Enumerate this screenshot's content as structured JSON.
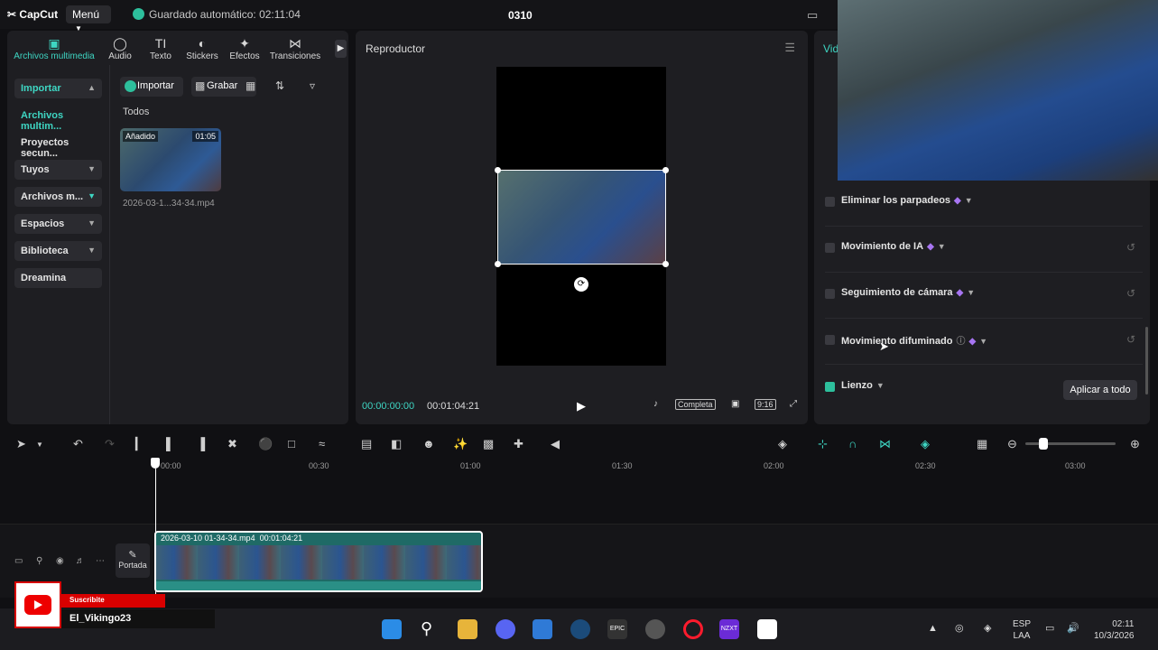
{
  "titlebar": {
    "logo": "CapCut",
    "menu_label": "Menú",
    "autosave": "Guardado automático: 02:11:04",
    "project": "0310"
  },
  "media_tabs": [
    {
      "label": "Archivos multimedia",
      "icon": "media-icon",
      "active": true
    },
    {
      "label": "Audio",
      "icon": "audio-icon"
    },
    {
      "label": "Texto",
      "icon": "text-icon"
    },
    {
      "label": "Stickers",
      "icon": "sticker-icon"
    },
    {
      "label": "Efectos",
      "icon": "effects-icon"
    },
    {
      "label": "Transiciones",
      "icon": "transitions-icon"
    }
  ],
  "sidebar": {
    "items": [
      {
        "label": "Importar",
        "boxed": true,
        "active": true,
        "chevron": "up"
      },
      {
        "label": "Archivos multim...",
        "active": true
      },
      {
        "label": "Proyectos secun..."
      },
      {
        "label": "Tuyos",
        "boxed": true,
        "chevron": "down"
      },
      {
        "label": "Archivos m...",
        "boxed": true,
        "chevron": "down"
      },
      {
        "label": "Espacios",
        "boxed": true,
        "chevron": "down"
      },
      {
        "label": "Biblioteca",
        "boxed": true,
        "chevron": "down"
      },
      {
        "label": "Dreamina",
        "boxed": true
      }
    ]
  },
  "media_toolbar": {
    "import_label": "Importar",
    "record_label": "Grabar"
  },
  "media_grid": {
    "group_label": "Todos",
    "items": [
      {
        "badge": "Añadido",
        "duration": "01:05",
        "name": "2026-03-1...34-34.mp4"
      }
    ]
  },
  "player": {
    "title": "Reproductor",
    "current_time": "00:00:00:00",
    "total_time": "00:01:04:21",
    "full_label": "Completa",
    "ratio_label": "9:16"
  },
  "right_panel": {
    "tab_label": "Vid",
    "options": [
      {
        "label": "Eliminar los parpadeos",
        "checked": false,
        "premium": true,
        "reset": false
      },
      {
        "label": "Movimiento de IA",
        "checked": false,
        "premium": true,
        "reset": true
      },
      {
        "label": "Seguimiento de cámara",
        "checked": false,
        "premium": true,
        "reset": true
      },
      {
        "label": "Movimiento difuminado",
        "checked": false,
        "premium": true,
        "reset": true
      },
      {
        "label": "Lienzo",
        "checked": true,
        "premium": false,
        "reset": false
      }
    ],
    "apply_all_label": "Aplicar a todo"
  },
  "timeline": {
    "ruler_ticks": [
      "00:00",
      "00:30",
      "01:00",
      "01:30",
      "02:00",
      "02:30",
      "03:00"
    ],
    "cover_label": "Portada",
    "clip_name": "2026-03-10 01-34-34.mp4",
    "clip_duration": "00:01:04:21"
  },
  "overlay": {
    "subscribe_label": "Suscribite",
    "channel_name": "El_Vikingo23"
  },
  "taskbar": {
    "lang": "ESP",
    "layout": "LAA",
    "time": "02:11",
    "date": "10/3/2026"
  },
  "colors": {
    "accent": "#3ed6c3",
    "premium": "#a775f2",
    "panel_bg": "#1e1e22"
  }
}
